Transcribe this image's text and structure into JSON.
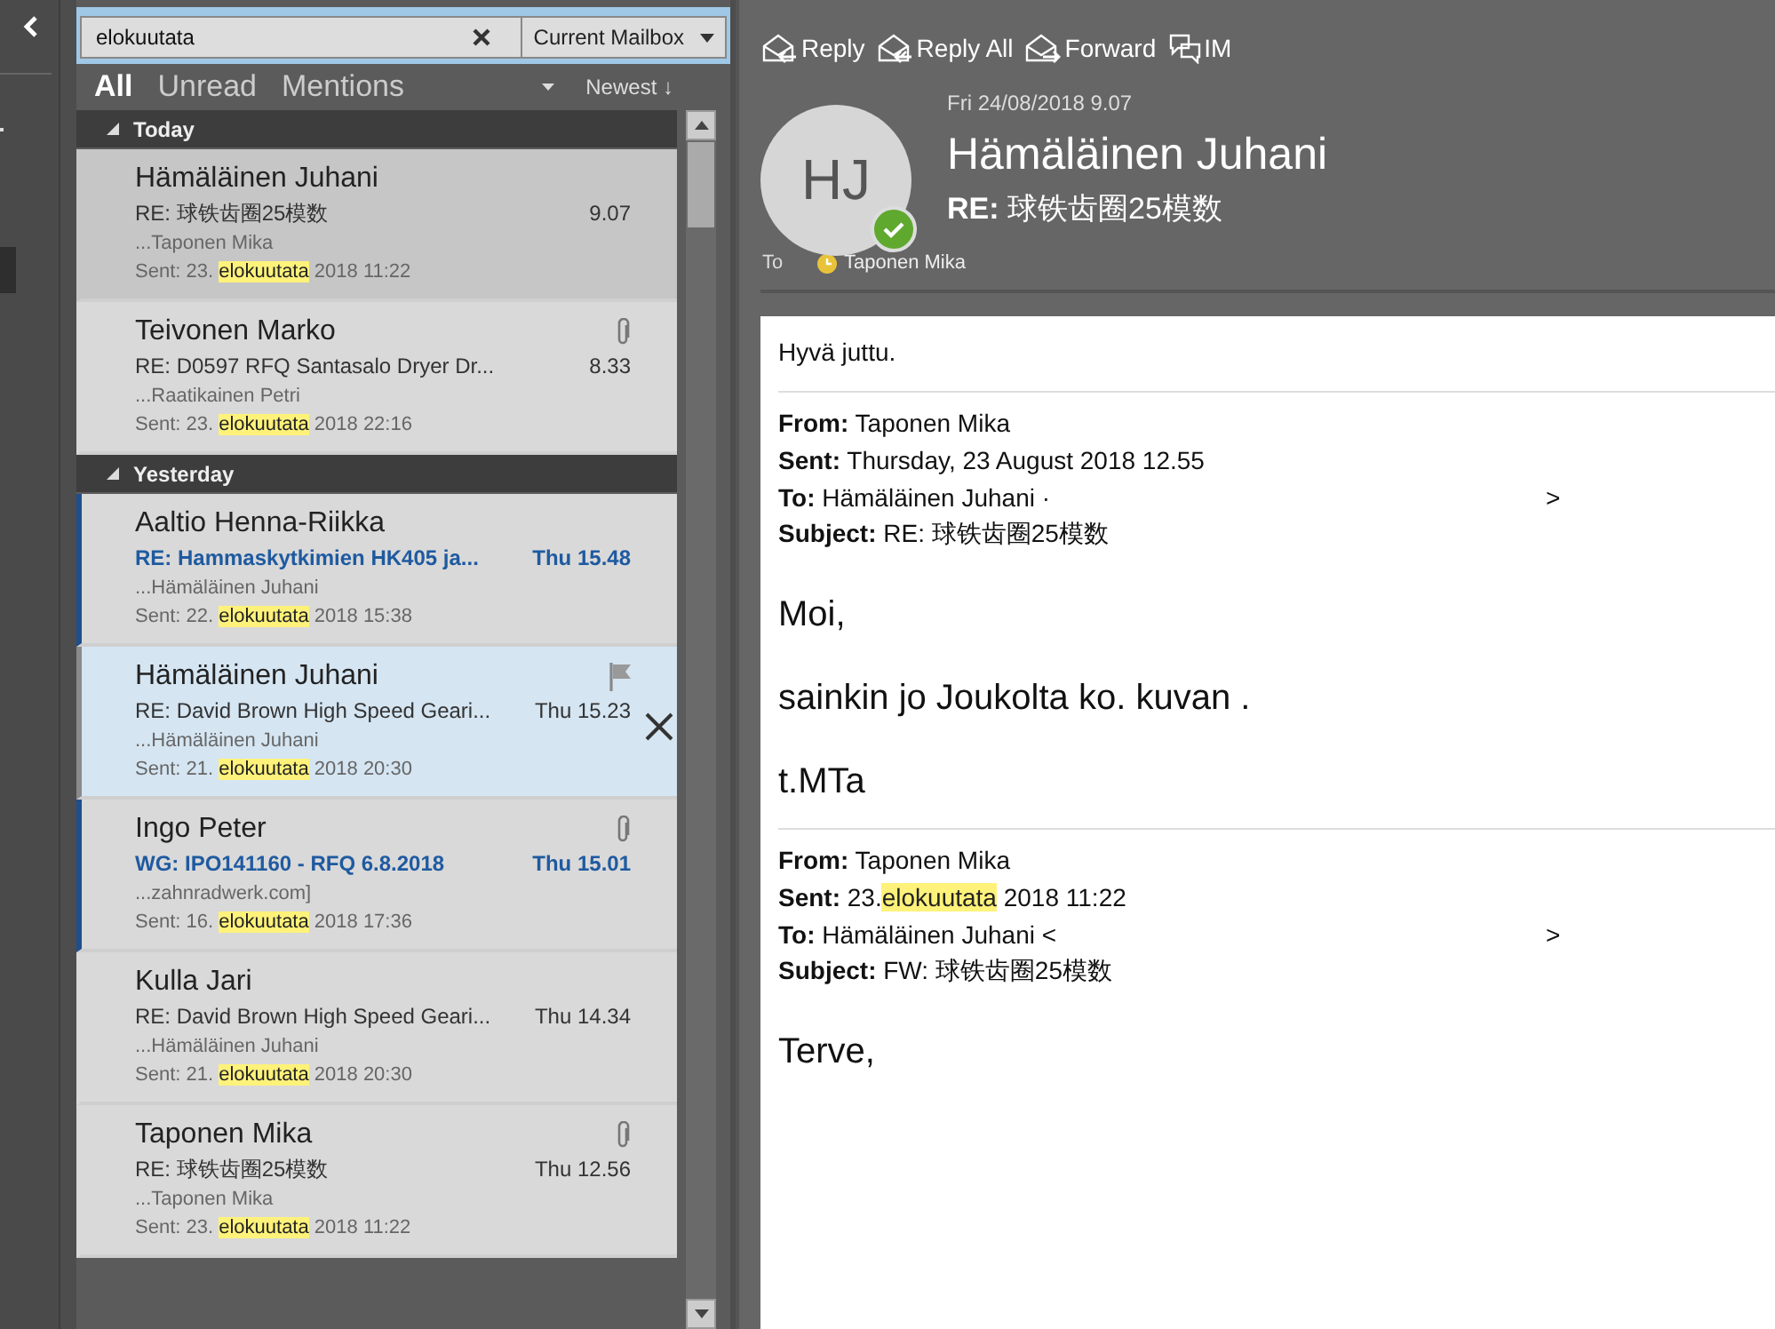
{
  "search": {
    "value": "elokuutata",
    "scope": "Current Mailbox"
  },
  "filters": [
    {
      "label": "All",
      "selected": true
    },
    {
      "label": "Unread",
      "selected": false
    },
    {
      "label": "Mentions",
      "selected": false
    }
  ],
  "sort": {
    "label": "Newest ↓"
  },
  "groups": [
    {
      "label": "Today",
      "expanded": true,
      "items": [
        {
          "sender": "Hämäläinen Juhani",
          "subject": "RE: 球铁齿圈25模数",
          "time": "9.07",
          "preview": "...Taponen Mika",
          "sent_before": "Sent: 23.",
          "sent_match": "elokuutata",
          "sent_after": "2018 11:22",
          "unread": false,
          "selected": true,
          "hovered": false,
          "attachment": false
        },
        {
          "sender": "Teivonen Marko",
          "subject": "RE: D0597 RFQ Santasalo Dryer Dr...",
          "time": "8.33",
          "preview": "...Raatikainen Petri",
          "sent_before": "Sent: 23.",
          "sent_match": "elokuutata",
          "sent_after": "2018 22:16",
          "unread": false,
          "selected": false,
          "hovered": false,
          "attachment": true
        }
      ]
    },
    {
      "label": "Yesterday",
      "expanded": true,
      "items": [
        {
          "sender": "Aaltio Henna-Riikka",
          "subject": "RE: Hammaskytkimien HK405 ja...",
          "time": "Thu 15.48",
          "preview": "...Hämäläinen Juhani",
          "sent_before": "Sent: 22.",
          "sent_match": "elokuutata",
          "sent_after": "2018 15:38",
          "unread": true,
          "selected": false,
          "hovered": false,
          "attachment": false
        },
        {
          "sender": "Hämäläinen Juhani",
          "subject": "RE: David Brown High Speed Geari...",
          "time": "Thu 15.23",
          "preview": "...Hämäläinen Juhani",
          "sent_before": "Sent: 21.",
          "sent_match": "elokuutata",
          "sent_after": "2018 20:30",
          "unread": false,
          "selected": false,
          "hovered": true,
          "attachment": false
        },
        {
          "sender": "Ingo Peter",
          "subject": "WG: IPO141160 - RFQ 6.8.2018",
          "time": "Thu 15.01",
          "preview": "...zahnradwerk.com]",
          "sent_before": "Sent: 16.",
          "sent_match": "elokuutata",
          "sent_after": "2018 17:36",
          "unread": true,
          "selected": false,
          "hovered": false,
          "attachment": true
        },
        {
          "sender": "Kulla Jari",
          "subject": "RE: David Brown High Speed Geari...",
          "time": "Thu 14.34",
          "preview": "...Hämäläinen Juhani",
          "sent_before": "Sent: 21.",
          "sent_match": "elokuutata",
          "sent_after": "2018 20:30",
          "unread": false,
          "selected": false,
          "hovered": false,
          "attachment": false
        },
        {
          "sender": "Taponen Mika",
          "subject": "RE: 球铁齿圈25模数",
          "time": "Thu 12.56",
          "preview": "...Taponen Mika",
          "sent_before": "Sent: 23.",
          "sent_match": "elokuutata",
          "sent_after": "2018 11:22",
          "unread": false,
          "selected": false,
          "hovered": false,
          "attachment": true
        }
      ]
    }
  ],
  "actions": [
    {
      "label": "Reply",
      "kind": "reply"
    },
    {
      "label": "Reply All",
      "kind": "replyall"
    },
    {
      "label": "Forward",
      "kind": "forward"
    },
    {
      "label": "IM",
      "kind": "im"
    }
  ],
  "message": {
    "initials": "HJ",
    "date": "Fri 24/08/2018 9.07",
    "sender": "Hämäläinen Juhani",
    "subject": "**RE:** 球铁齿圈25模数",
    "to_label": "To",
    "to": "Taponen Mika"
  },
  "body": [
    {
      "kind": "para",
      "text": "Hyvä juttu."
    },
    {
      "kind": "header",
      "lines": [
        {
          "label": "From:",
          "value": "Taponen Mika"
        },
        {
          "label": "Sent:",
          "value": "Thursday, 23 August 2018 12.55"
        },
        {
          "label": "To:",
          "value": "Hämäläinen Juhani ·",
          "tail": ">"
        },
        {
          "label": "Subject:",
          "value": "RE: 球铁齿圈25模数"
        }
      ]
    },
    {
      "kind": "large",
      "text": "Moi,"
    },
    {
      "kind": "large",
      "text": "sainkin jo Joukolta ko. kuvan ."
    },
    {
      "kind": "large",
      "text": "t.MTa"
    },
    {
      "kind": "header",
      "lines": [
        {
          "label": "From:",
          "value": "Taponen Mika"
        },
        {
          "label": "Sent:",
          "value": "23.",
          "match": "elokuutata",
          "after": "2018 11:22"
        },
        {
          "label": "To:",
          "value": "Hämäläinen Juhani <",
          "tail": ">"
        },
        {
          "label": "Subject:",
          "value": "FW: 球铁齿圈25模数"
        }
      ]
    },
    {
      "kind": "large",
      "text": "Terve,"
    }
  ]
}
